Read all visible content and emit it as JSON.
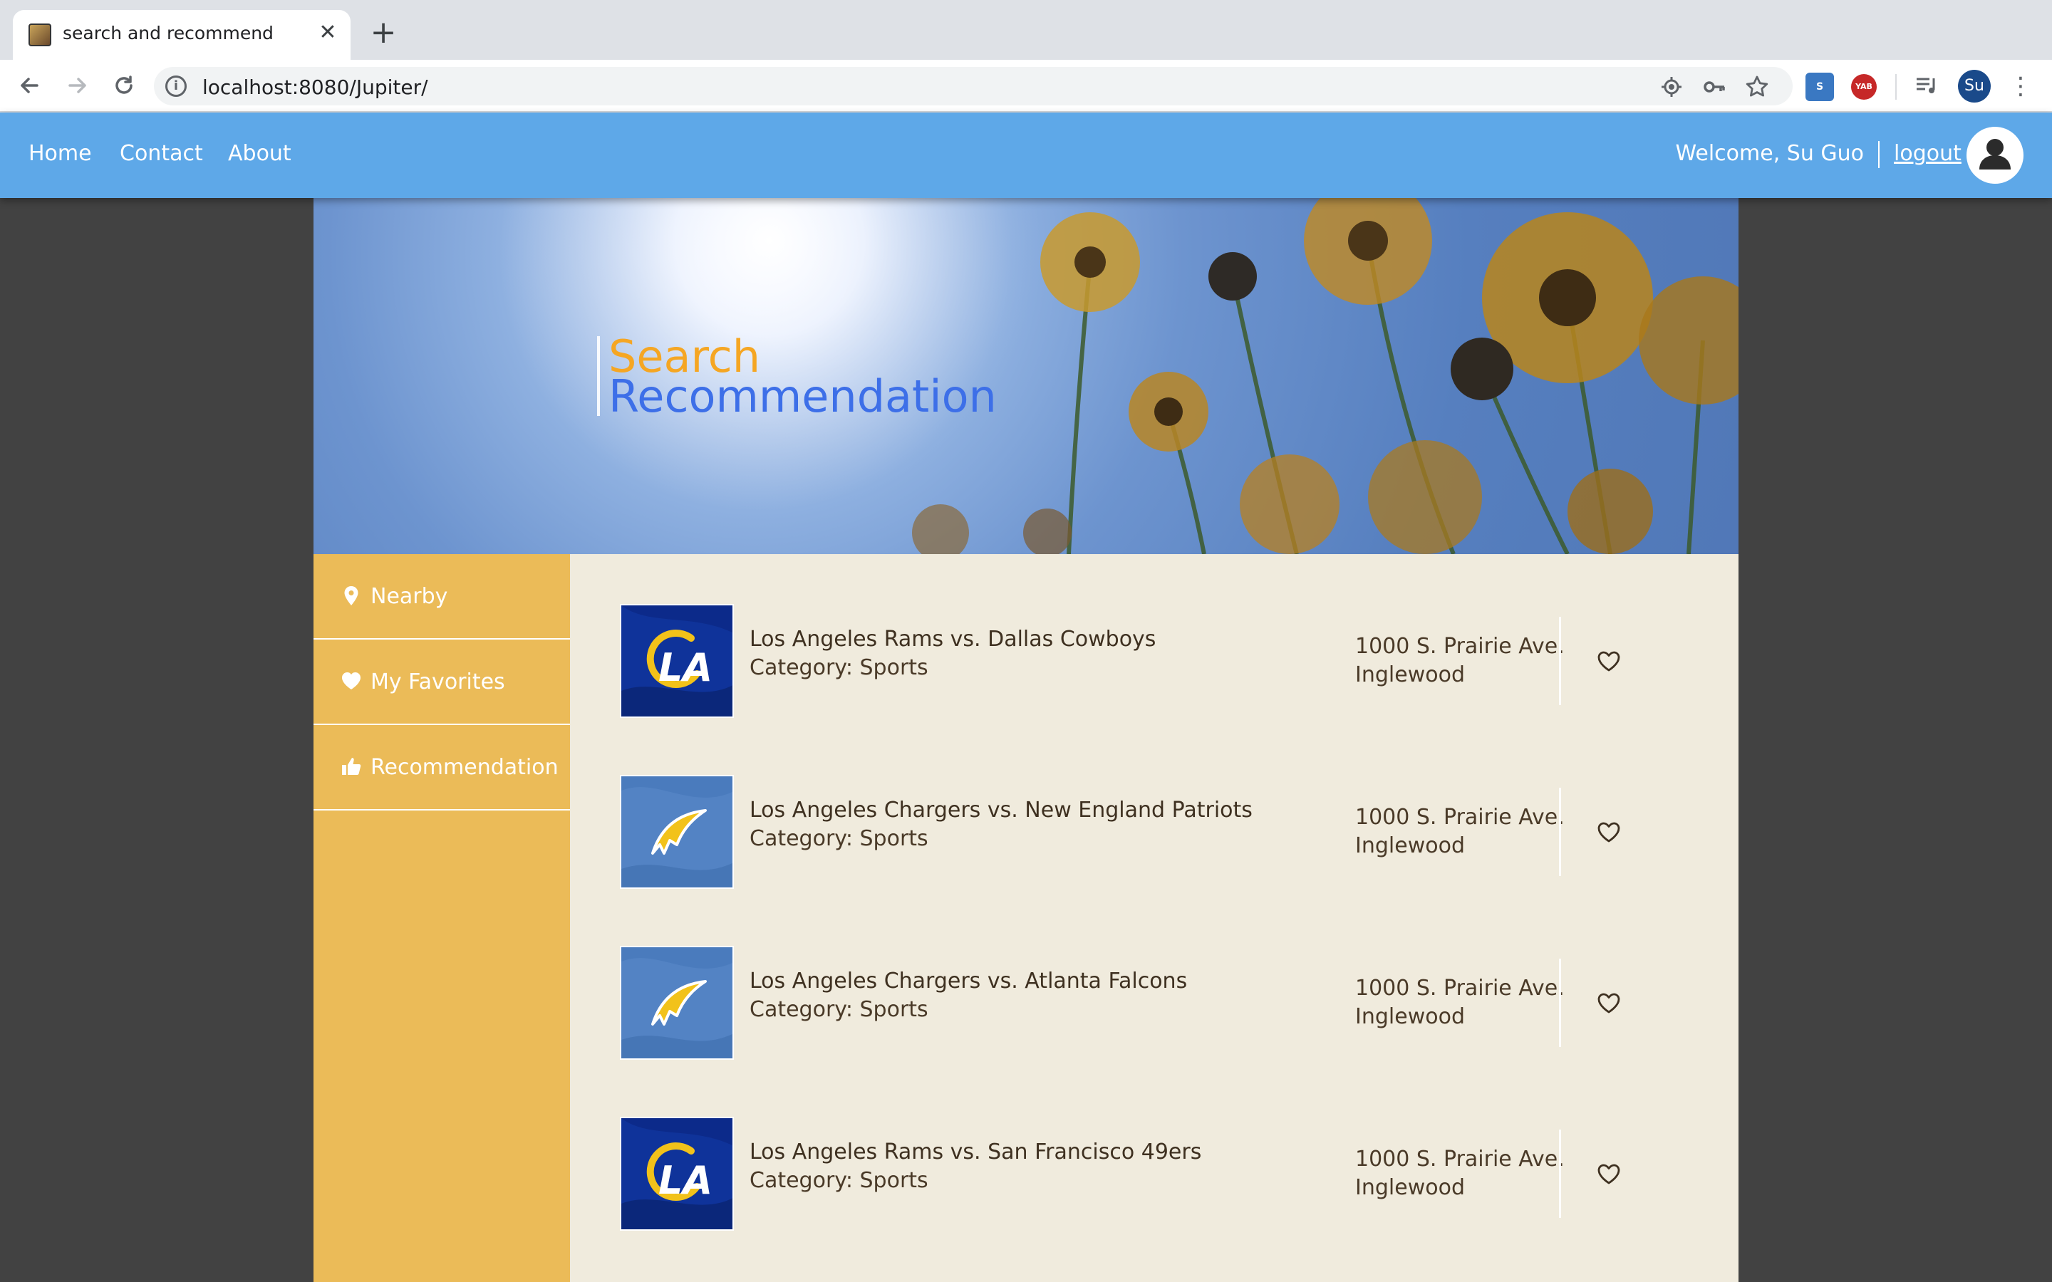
{
  "browser": {
    "tab_title": "search and recommend",
    "tab_close": "✕",
    "new_tab": "+",
    "url_host": "localhost",
    "url_rest": ":8080/Jupiter/",
    "profile_initials": "Su",
    "extensions": [
      "S",
      "YAB"
    ]
  },
  "header": {
    "nav": [
      "Home",
      "Contact",
      "About"
    ],
    "welcome": "Welcome, Su Guo",
    "logout": "logout",
    "bg_color": "#5ea8e8"
  },
  "hero": {
    "title_line1": "Search",
    "title_line2": "Recommendation",
    "line1_color": "#f5a623",
    "line2_color": "#3d6fe8"
  },
  "sidebar": {
    "items": [
      {
        "label": "Nearby",
        "icon": "map-marker-icon"
      },
      {
        "label": "My Favorites",
        "icon": "heart-icon"
      },
      {
        "label": "Recommendation",
        "icon": "thumbs-up-icon"
      }
    ],
    "bg_color": "#ebbb58"
  },
  "items": [
    {
      "name": "Los Angeles Rams vs. Dallas Cowboys",
      "category": "Category: Sports",
      "address_line1": "1000 S. Prairie Ave.",
      "address_line2": "Inglewood",
      "logo": "rams-logo"
    },
    {
      "name": "Los Angeles Chargers vs. New England Patriots",
      "category": "Category: Sports",
      "address_line1": "1000 S. Prairie Ave.",
      "address_line2": "Inglewood",
      "logo": "chargers-logo"
    },
    {
      "name": "Los Angeles Chargers vs. Atlanta Falcons",
      "category": "Category: Sports",
      "address_line1": "1000 S. Prairie Ave.",
      "address_line2": "Inglewood",
      "logo": "chargers-logo"
    },
    {
      "name": "Los Angeles Rams vs. San Francisco 49ers",
      "category": "Category: Sports",
      "address_line1": "1000 S. Prairie Ave.",
      "address_line2": "Inglewood",
      "logo": "rams-logo"
    }
  ]
}
